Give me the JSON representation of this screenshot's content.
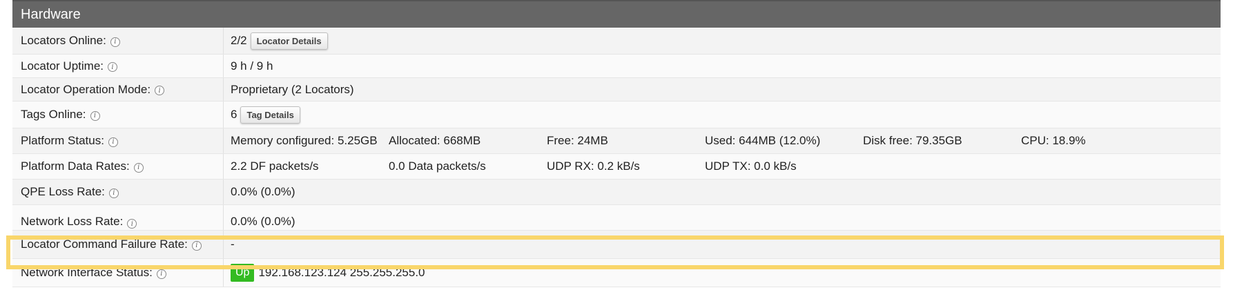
{
  "header": {
    "title": "Hardware"
  },
  "rows": {
    "locators_online": {
      "label": "Locators Online:",
      "value": "2/2",
      "button": "Locator Details"
    },
    "locator_uptime": {
      "label": "Locator Uptime:",
      "value": "9 h / 9 h"
    },
    "locator_operation_mode": {
      "label": "Locator Operation Mode:",
      "value": "Proprietary (2 Locators)"
    },
    "tags_online": {
      "label": "Tags Online:",
      "value": "6",
      "button": "Tag Details"
    },
    "platform_status": {
      "label": "Platform Status:",
      "values": [
        "Memory configured: 5.25GB",
        "Allocated: 668MB",
        "Free: 24MB",
        "Used: 644MB (12.0%)",
        "Disk free: 79.35GB",
        "CPU: 18.9%"
      ]
    },
    "platform_data_rates": {
      "label": "Platform Data Rates:",
      "values": [
        "2.2 DF packets/s",
        "0.0 Data packets/s",
        "UDP RX: 0.2 kB/s",
        "UDP TX: 0.0 kB/s"
      ]
    },
    "qpe_loss_rate": {
      "label": "QPE Loss Rate:",
      "value": "0.0% (0.0%)"
    },
    "network_loss_rate": {
      "label": "Network Loss Rate:",
      "value": "0.0% (0.0%)"
    },
    "locator_command_failure_rate": {
      "label": "Locator Command Failure Rate:",
      "value": "-"
    },
    "network_interface_status": {
      "label": "Network Interface Status:",
      "status": "Up",
      "value": "192.168.123.124 255.255.255.0"
    }
  },
  "info_icon": {
    "glyph": "i",
    "name": "info-icon"
  },
  "colors": {
    "header_bg": "#666666",
    "highlight": "#f9d66b",
    "status_up": "#33bb22"
  }
}
